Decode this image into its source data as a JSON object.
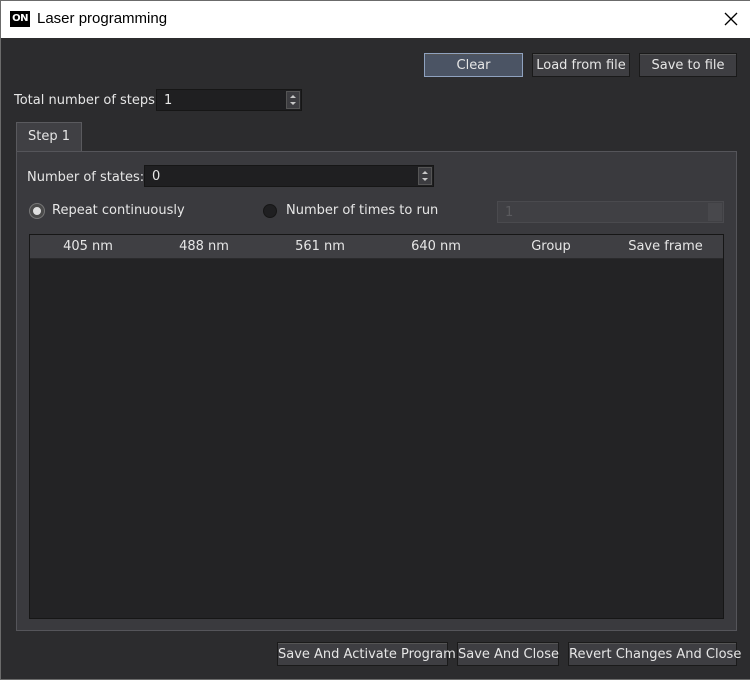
{
  "window": {
    "title": "Laser programming",
    "app_icon_text": "ON",
    "close_glyph": "✕"
  },
  "toolbar": {
    "clear": "Clear",
    "load": "Load from file",
    "save": "Save to file"
  },
  "steps": {
    "label": "Total number of steps:",
    "value": "1"
  },
  "tabs": [
    {
      "label": "Step 1"
    }
  ],
  "states": {
    "label": "Number of states:",
    "value": "0"
  },
  "run_mode": {
    "repeat_label": "Repeat continuously",
    "times_label": "Number of times to run",
    "times_value": "1",
    "selected": "repeat"
  },
  "table": {
    "columns": [
      "405 nm",
      "488 nm",
      "561 nm",
      "640 nm",
      "Group",
      "Save frame"
    ],
    "rows": []
  },
  "footer": {
    "activate": "Save And Activate Program",
    "save_close": "Save And Close",
    "revert": "Revert Changes And Close"
  },
  "colors": {
    "background": "#2c2c2e",
    "panel": "#3a3a3e",
    "primary_border": "#8fa2bf"
  }
}
